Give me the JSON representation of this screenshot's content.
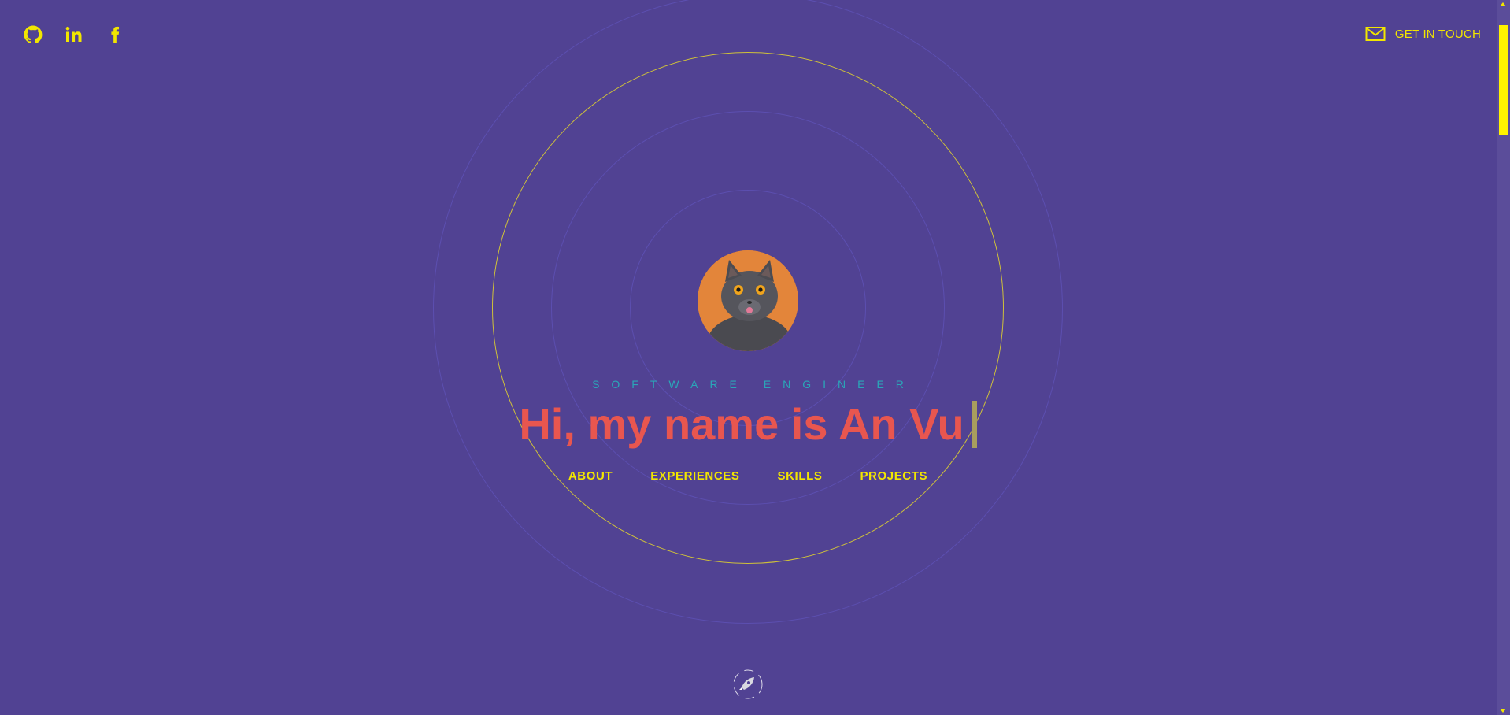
{
  "social": {
    "github_icon": "github-icon",
    "linkedin_icon": "linkedin-icon",
    "facebook_icon": "facebook-icon"
  },
  "contact": {
    "icon": "mail-icon",
    "label": "GET IN TOUCH"
  },
  "hero": {
    "avatar_alt": "cat avatar",
    "subtitle": "SOFTWARE ENGINEER",
    "headline": "Hi, my name is An Vu"
  },
  "nav": {
    "items": [
      {
        "label": "ABOUT"
      },
      {
        "label": "EXPERIENCES"
      },
      {
        "label": "SKILLS"
      },
      {
        "label": "PROJECTS"
      }
    ]
  },
  "colors": {
    "background": "#514293",
    "accent_yellow": "#f2e600",
    "headline_red": "#e8564f",
    "subtitle_teal": "#2aa6b8",
    "avatar_orange": "#e3853a"
  }
}
